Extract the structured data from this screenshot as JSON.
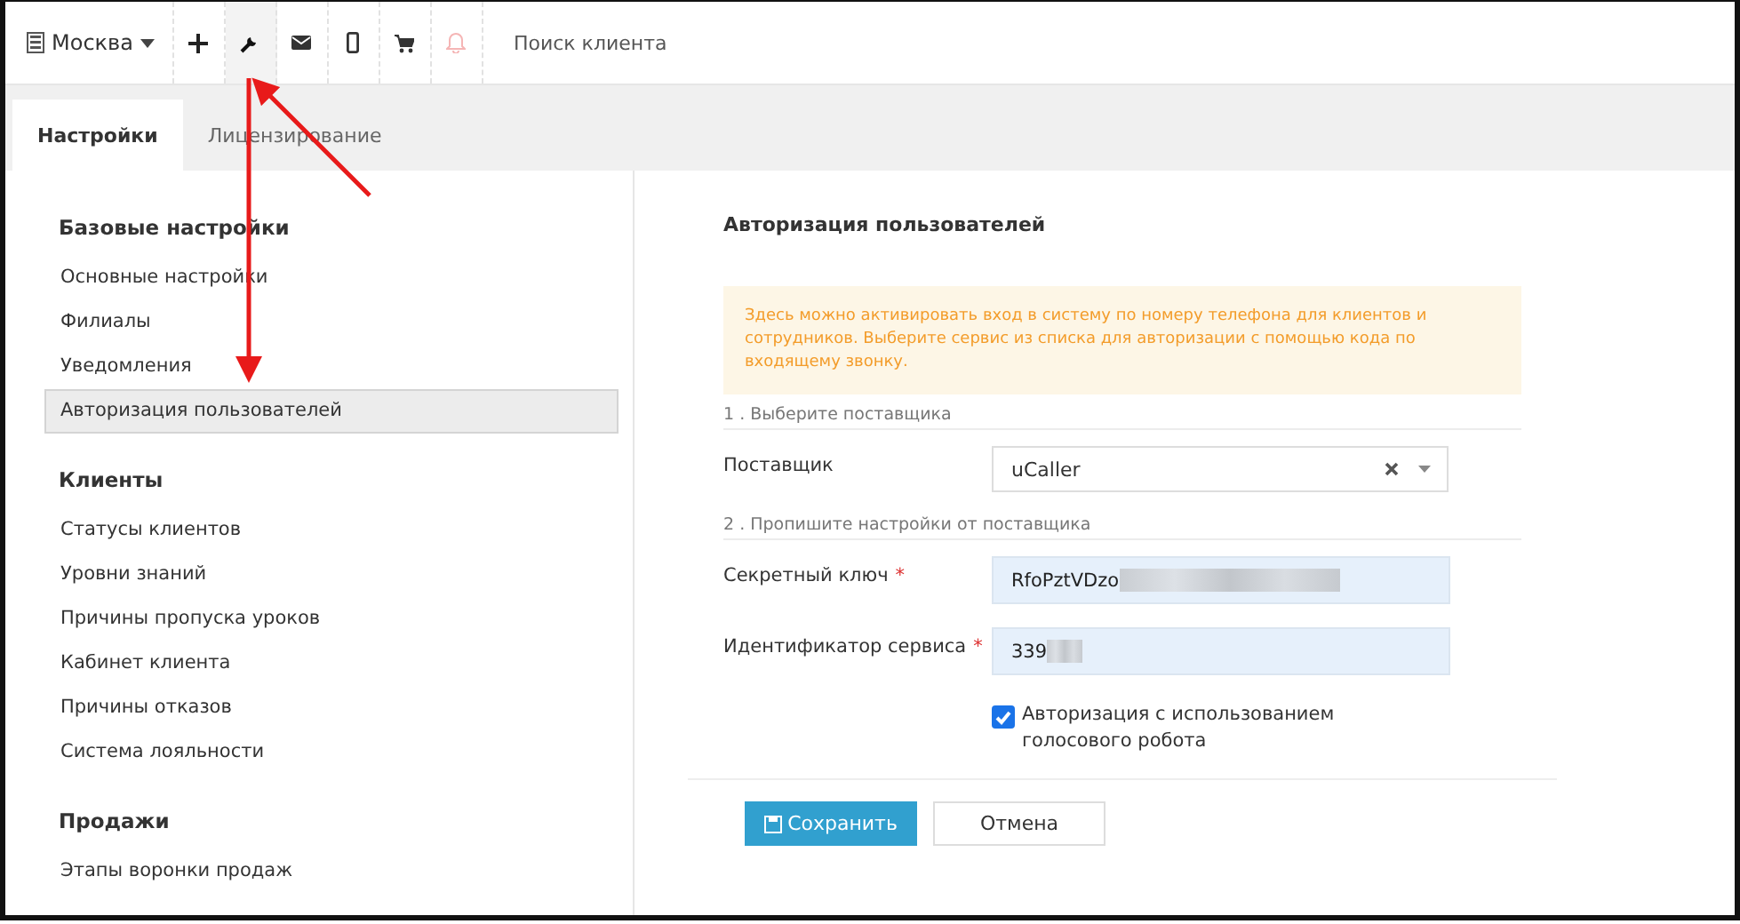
{
  "topbar": {
    "branch": "Москва",
    "tools": [
      {
        "kind": "plus",
        "selected": false
      },
      {
        "kind": "wrench",
        "selected": true
      },
      {
        "kind": "mail",
        "selected": false
      },
      {
        "kind": "phone",
        "selected": false
      },
      {
        "kind": "cart",
        "selected": false
      },
      {
        "kind": "bell",
        "selected": false
      }
    ],
    "search": {
      "placeholder": "Поиск клиента"
    }
  },
  "tabs": [
    {
      "label": "Настройки",
      "selected": true
    },
    {
      "label": "Лицензирование",
      "selected": false
    }
  ],
  "sidebar": {
    "sections": [
      {
        "title": "Базовые настройки",
        "items": [
          {
            "label": "Основные настройки",
            "selected": false
          },
          {
            "label": "Филиалы",
            "selected": false
          },
          {
            "label": "Уведомления",
            "selected": false
          },
          {
            "label": "Авторизация пользователей",
            "selected": true
          }
        ]
      },
      {
        "title": "Клиенты",
        "items": [
          {
            "label": "Статусы клиентов",
            "selected": false
          },
          {
            "label": "Уровни знаний",
            "selected": false
          },
          {
            "label": "Причины пропуска уроков",
            "selected": false
          },
          {
            "label": "Кабинет клиента",
            "selected": false
          },
          {
            "label": "Причины отказов",
            "selected": false
          },
          {
            "label": "Система лояльности",
            "selected": false
          }
        ]
      },
      {
        "title": "Продажи",
        "items": [
          {
            "label": "Этапы воронки продаж",
            "selected": false
          }
        ]
      }
    ]
  },
  "panel": {
    "title": "Авторизация пользователей",
    "notice": "Здесь можно активировать вход в систему по номеру телефона для клиентов и сотрудников. Выберите сервис из списка для авторизации с помощью кода по входящему звонку.",
    "step_1": "1 . Выберите поставщика",
    "provider": {
      "label": "Поставщик",
      "value": "uCaller"
    },
    "step_2": "2 . Пропишите настройки от поставщика",
    "fields": [
      {
        "label": "Секретный ключ",
        "required_mark": "*",
        "value": "RfoPztVDzo"
      },
      {
        "label": "Идентификатор сервиса",
        "required_mark": "*",
        "value": "339"
      }
    ],
    "voice_robot": {
      "label": "Авторизация с использованием голосового робота",
      "checked": true
    },
    "buttons": [
      {
        "label": "Сохранить",
        "kind": "primary"
      },
      {
        "label": "Отмена",
        "kind": "default"
      }
    ]
  }
}
